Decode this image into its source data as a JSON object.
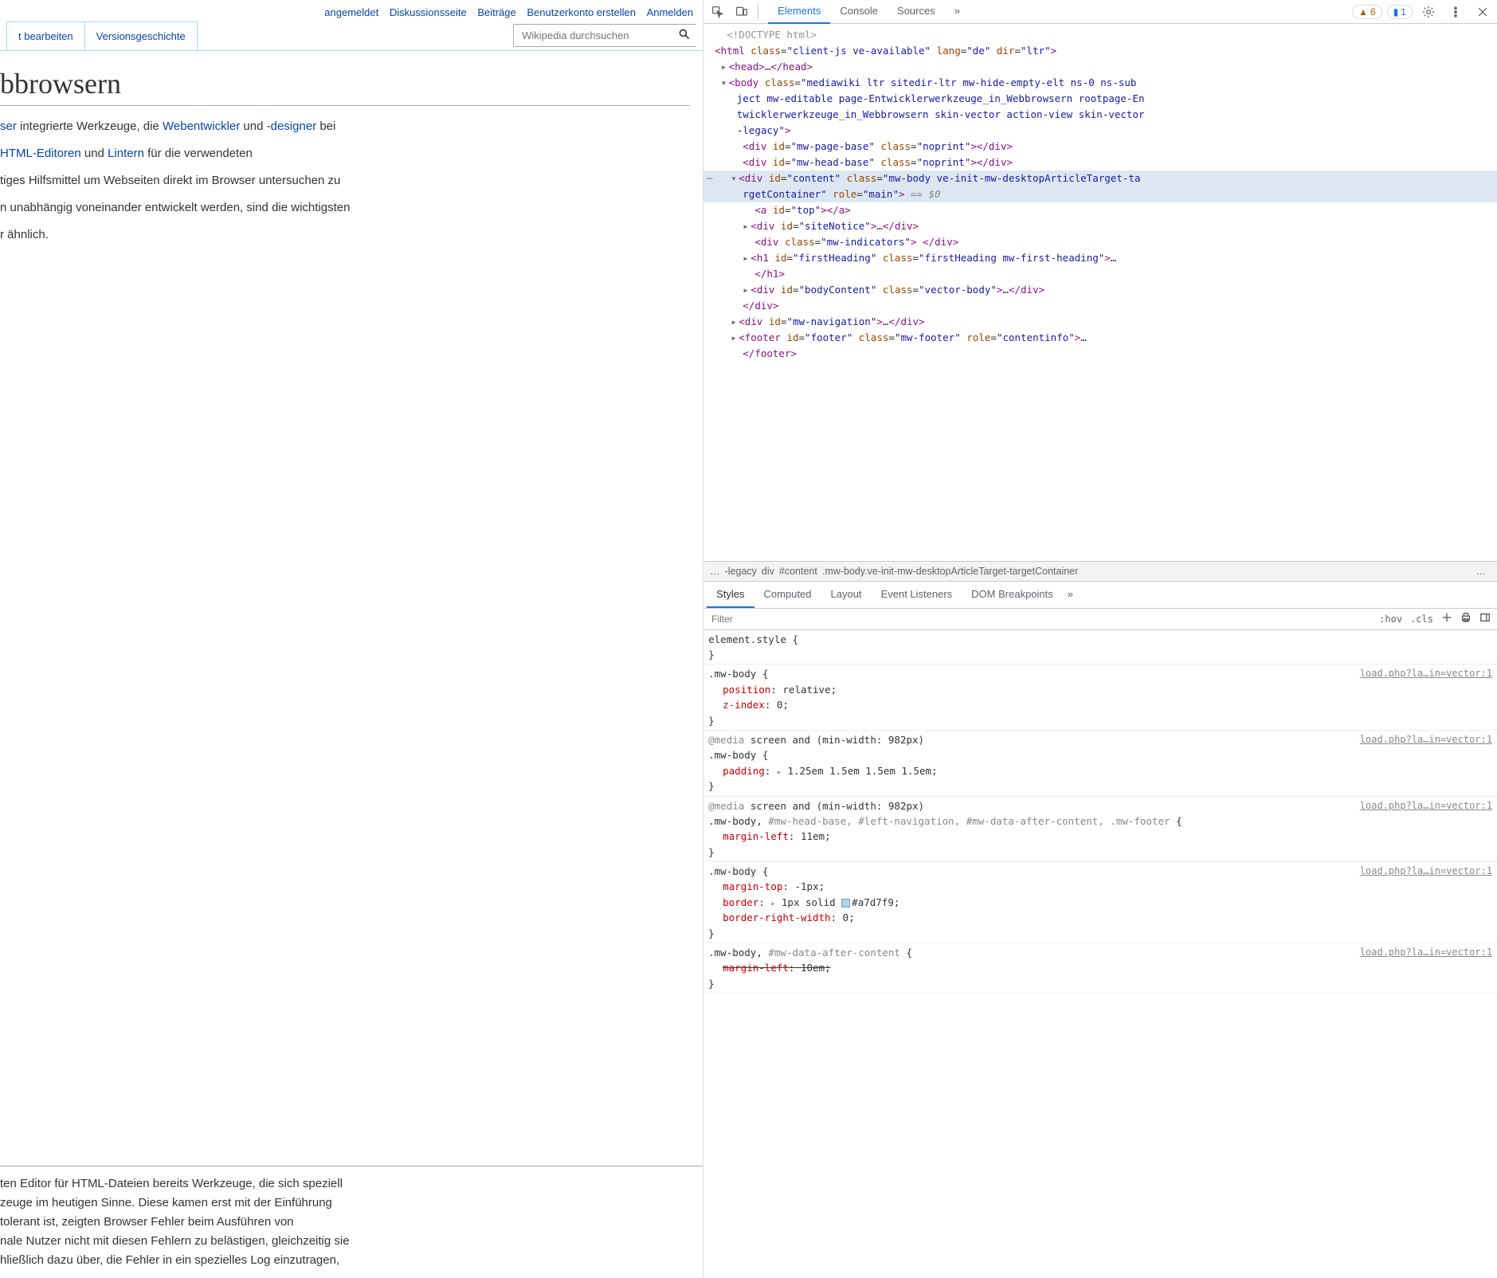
{
  "wiki": {
    "topLinks": [
      "angemeldet",
      "Diskussionsseite",
      "Beiträge",
      "Benutzerkonto erstellen",
      "Anmelden"
    ],
    "tabs": [
      "t bearbeiten",
      "Versionsgeschichte"
    ],
    "searchPlaceholder": "Wikipedia durchsuchen",
    "title": "bbrowsern",
    "p1a": "ser",
    "p1b": " integrierte Werkzeuge, die ",
    "p1c": "Webentwickler",
    "p1d": " und -",
    "p1e": "designer",
    "p1f": " bei ",
    "p2a": "HTML-Editoren",
    "p2b": " und ",
    "p2c": "Lintern",
    "p2d": " für die verwendeten",
    "p3": "tiges Hilfsmittel um Webseiten direkt im Browser untersuchen zu",
    "p4": "n unabhängig voneinander entwickelt werden, sind die wichtigsten",
    "p5": "r ähnlich.",
    "bp1a": "ten Editor für ",
    "bp1b": "HTML",
    "bp1c": "-Dateien bereits Werkzeuge, die sich speziell",
    "bp2": "zeuge im heutigen Sinne. Diese kamen erst mit der Einführung",
    "bp3": "tolerant ist, zeigten Browser Fehler beim Ausführen von",
    "bp4": "nale Nutzer nicht mit diesen Fehlern zu belästigen, gleichzeitig sie",
    "bp5a": "hließlich dazu über, die Fehler in ein spezielles ",
    "bp5b": "Log",
    "bp5c": " einzutragen,"
  },
  "devtools": {
    "tabs": [
      "Elements",
      "Console",
      "Sources"
    ],
    "warnCount": "6",
    "infoCount": "1",
    "dom": {
      "doctype": "<!DOCTYPE html>",
      "htmlOpen": "<html class=\"client-js ve-available\" lang=\"de\" dir=\"ltr\">",
      "head": "<head>…</head>",
      "bodyOpen": "<body class=\"mediawiki ltr sitedir-ltr mw-hide-empty-elt ns-0 ns-subject mw-editable page-Entwicklerwerkzeuge_in_Webbrowsern rootpage-Entwicklerwerkzeuge_in_Webbrowsern skin-vector action-view skin-vector-legacy\">",
      "pageBase": "<div id=\"mw-page-base\" class=\"noprint\"></div>",
      "headBase": "<div id=\"mw-head-base\" class=\"noprint\"></div>",
      "contentOpen": "<div id=\"content\" class=\"mw-body ve-init-mw-desktopArticleTarget-targetContainer\" role=\"main\">",
      "selSuffix": " == $0",
      "aTop": "<a id=\"top\"></a>",
      "siteNotice": "<div id=\"siteNotice\">…</div>",
      "indicators": "<div class=\"mw-indicators\"> </div>",
      "h1": "<h1 id=\"firstHeading\" class=\"firstHeading mw-first-heading\">…</h1>",
      "bodyContent": "<div id=\"bodyContent\" class=\"vector-body\">…</div>",
      "divClose": "</div>",
      "nav": "<div id=\"mw-navigation\">…</div>",
      "footer": "<footer id=\"footer\" class=\"mw-footer\" role=\"contentinfo\">…</footer>"
    },
    "crumb": {
      "ell": "…",
      "legacy": "-legacy",
      "el": "div",
      "id": "#content",
      "cls": ".mw-body.ve-init-mw-desktopArticleTarget-targetContainer"
    },
    "subTabs": [
      "Styles",
      "Computed",
      "Layout",
      "Event Listeners",
      "DOM Breakpoints"
    ],
    "filterPlaceholder": "Filter",
    "hov": ":hov",
    "cls": ".cls",
    "styles": {
      "src": "load.php?la…in=vector:1",
      "elStyle": "element.style",
      "r1sel": ".mw-body",
      "r1p1n": "position",
      "r1p1v": "relative",
      "r1p2n": "z-index",
      "r1p2v": "0",
      "media": "@media screen and (min-width: 982px)",
      "r2sel": ".mw-body",
      "r2p1n": "padding",
      "r2p1v": "1.25em 1.5em 1.5em 1.5em",
      "r3sel": ".mw-body,",
      "r3selg": " #mw-head-base, #left-navigation, #mw-data-after-content, .mw-footer",
      "r3p1n": "margin-left",
      "r3p1v": "11em",
      "r4sel": ".mw-body",
      "r4p1n": "margin-top",
      "r4p1v": "-1px",
      "r4p2n": "border",
      "r4p2v": "1px solid ",
      "r4p2c": "#a7d7f9",
      "r4p3n": "border-right-width",
      "r4p3v": "0",
      "r5sel": ".mw-body,",
      "r5selg": " #mw-data-after-content",
      "r5p1n": "margin-left",
      "r5p1v": "10em"
    }
  }
}
